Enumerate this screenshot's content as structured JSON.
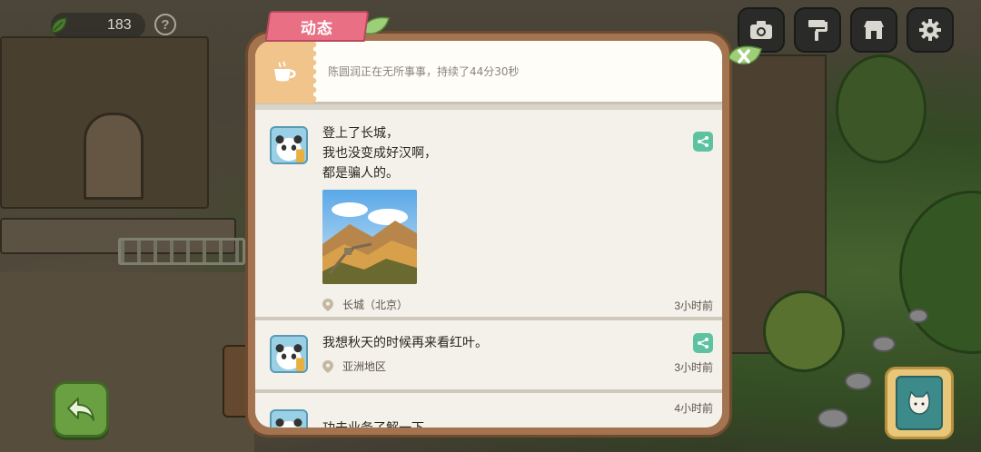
{
  "hud": {
    "currency_value": "183",
    "help_label": "?"
  },
  "panel": {
    "tab_label": "动态",
    "status_text": "陈圆润正在无所事事，持续了44分30秒"
  },
  "posts": [
    {
      "text": "登上了长城，\n我也没变成好汉啊，\n都是骗人的。",
      "location": "长城（北京）",
      "time": "3小时前",
      "has_photo": true
    },
    {
      "text": "我想秋天的时候再来看红叶。",
      "location": "亚洲地区",
      "time": "3小时前",
      "has_photo": false
    },
    {
      "text": "功夫业务了解一下",
      "time": "4小时前",
      "has_photo": false
    }
  ],
  "colors": {
    "tab_pink": "#e86f84",
    "panel_brown": "#a47450",
    "share_green": "#5cc2a0",
    "back_green": "#6aa042",
    "status_orange": "#f0c48a"
  },
  "icons": {
    "tools": [
      "camera-icon",
      "paint-roller-icon",
      "shop-icon",
      "gear-icon"
    ],
    "status": "coffee-cup-icon",
    "currency": "leaf-icon",
    "back": "back-arrow-icon",
    "book": "cat-book-icon"
  }
}
